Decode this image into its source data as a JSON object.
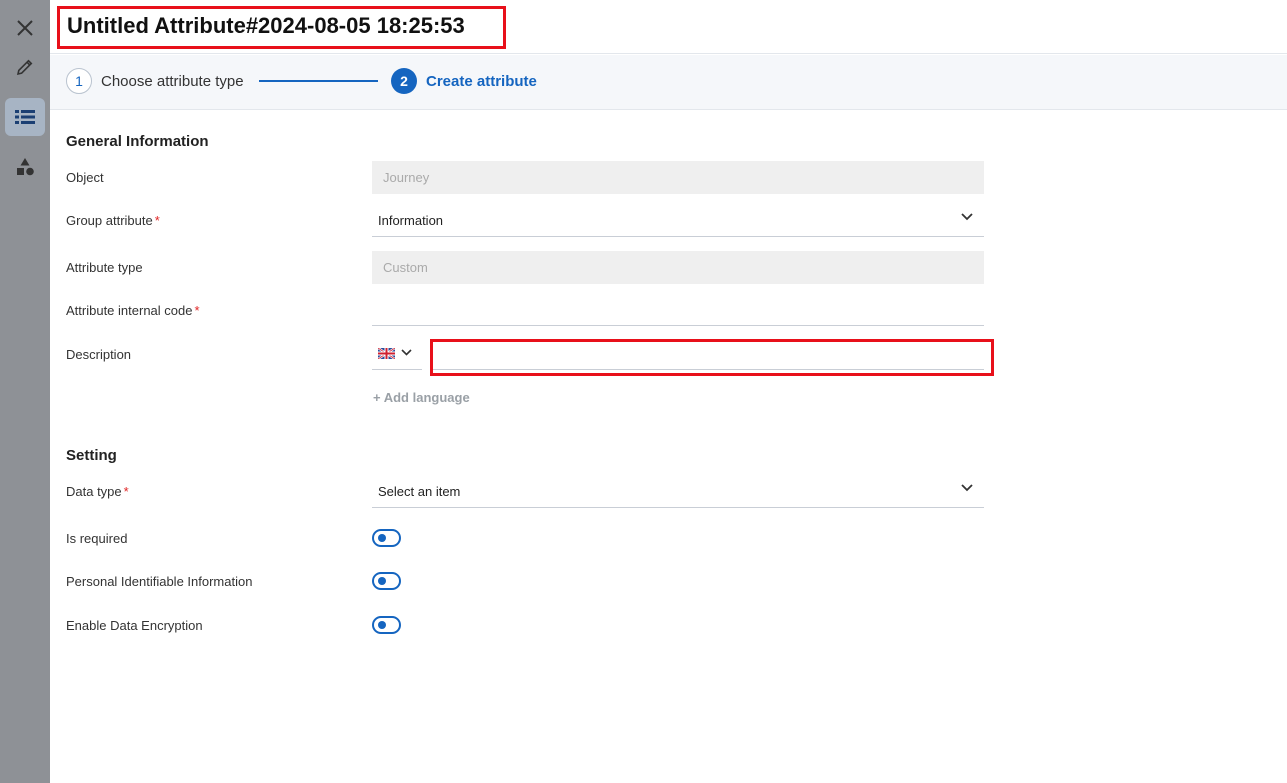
{
  "window": {
    "title": "Untitled Attribute#2024-08-05 18:25:53"
  },
  "rail": {
    "items": [
      {
        "icon": "close-icon"
      },
      {
        "icon": "pencil-icon"
      },
      {
        "icon": "list-icon",
        "active": true
      },
      {
        "icon": "shapes-icon"
      }
    ]
  },
  "stepper": {
    "steps": [
      {
        "number": "1",
        "label": "Choose attribute type"
      },
      {
        "number": "2",
        "label": "Create attribute"
      }
    ]
  },
  "general": {
    "heading": "General Information",
    "object": {
      "label": "Object",
      "value": "Journey"
    },
    "group_attribute": {
      "label": "Group attribute",
      "required": "*",
      "value": "Information"
    },
    "attribute_type": {
      "label": "Attribute type",
      "value": "Custom"
    },
    "internal_code": {
      "label": "Attribute internal code",
      "required": "*",
      "value": ""
    },
    "description": {
      "label": "Description",
      "value": "",
      "language_icon": "uk-flag-icon"
    },
    "add_language": "+ Add language"
  },
  "setting": {
    "heading": "Setting",
    "data_type": {
      "label": "Data type",
      "required": "*",
      "value": "Select an item"
    },
    "is_required": {
      "label": "Is required",
      "on": false
    },
    "pii": {
      "label": "Personal Identifiable Information",
      "on": false
    },
    "encryption": {
      "label": "Enable Data Encryption",
      "on": false
    }
  },
  "colors": {
    "accent": "#1565c0",
    "highlight": "#e8101a",
    "required": "#e02424"
  }
}
